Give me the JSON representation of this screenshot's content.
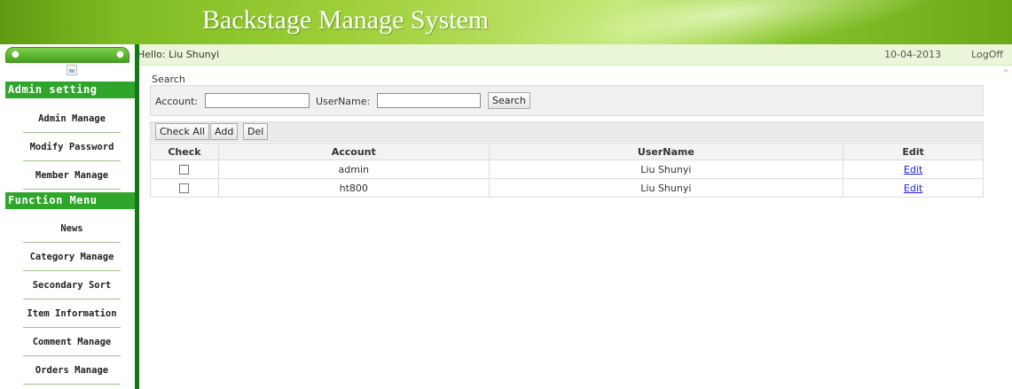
{
  "header": {
    "title": "Backstage Manage System"
  },
  "infobar": {
    "greeting": "Hello: Liu Shunyi",
    "date": "10-04-2013",
    "logoff": "LogOff"
  },
  "sidebar": {
    "section1": "Admin setting",
    "items1": [
      "Admin Manage",
      "Modify Password",
      "Member Manage"
    ],
    "section2": "Function Menu",
    "items2": [
      "News",
      "Category Manage",
      "Secondary Sort",
      "Item Information",
      "Comment Manage",
      "Orders Manage"
    ]
  },
  "search": {
    "label": "Search",
    "account_label": "Account:",
    "account_value": "",
    "username_label": "UserName:",
    "username_value": "",
    "button": "Search"
  },
  "toolbar": {
    "check_all": "Check All",
    "add": "Add",
    "del": "Del"
  },
  "table": {
    "headers": [
      "Check",
      "Account",
      "UserName",
      "Edit"
    ],
    "rows": [
      {
        "account": "admin",
        "username": "Liu Shunyi",
        "edit": "Edit"
      },
      {
        "account": "ht800",
        "username": "Liu Shunyi",
        "edit": "Edit"
      }
    ]
  }
}
